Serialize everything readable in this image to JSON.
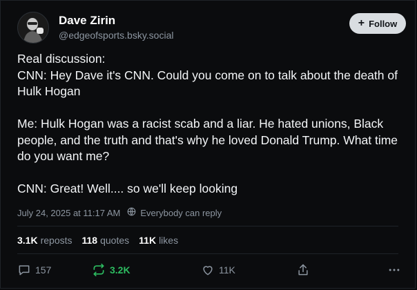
{
  "author": {
    "display_name": "Dave Zirin",
    "handle": "@edgeofsports.bsky.social"
  },
  "follow_button": {
    "label": "Follow",
    "icon": "plus-icon"
  },
  "post": {
    "lines_block1": [
      "Real discussion:",
      "CNN: Hey Dave it's CNN. Could you come on to talk about the death of Hulk Hogan"
    ],
    "block2": "Me: Hulk Hogan was a racist scab and a liar. He hated unions, Black people, and the truth and that's why he loved Donald Trump. What time do you want me?",
    "block3": "CNN: Great! Well.... so we'll keep looking"
  },
  "meta": {
    "timestamp": "July 24, 2025 at 11:17 AM",
    "visibility": "Everybody can reply"
  },
  "stats": {
    "reposts_count": "3.1K",
    "reposts_label": "reposts",
    "quotes_count": "118",
    "quotes_label": "quotes",
    "likes_count": "11K",
    "likes_label": "likes"
  },
  "actions": {
    "reply_count": "157",
    "repost_count": "3.2K",
    "like_count": "11K"
  },
  "colors": {
    "background": "#0b0c0e",
    "text": "#f4f6f8",
    "muted": "#8d96a1",
    "repost_active": "#2dbd61",
    "follow_bg": "#d9dde1"
  }
}
